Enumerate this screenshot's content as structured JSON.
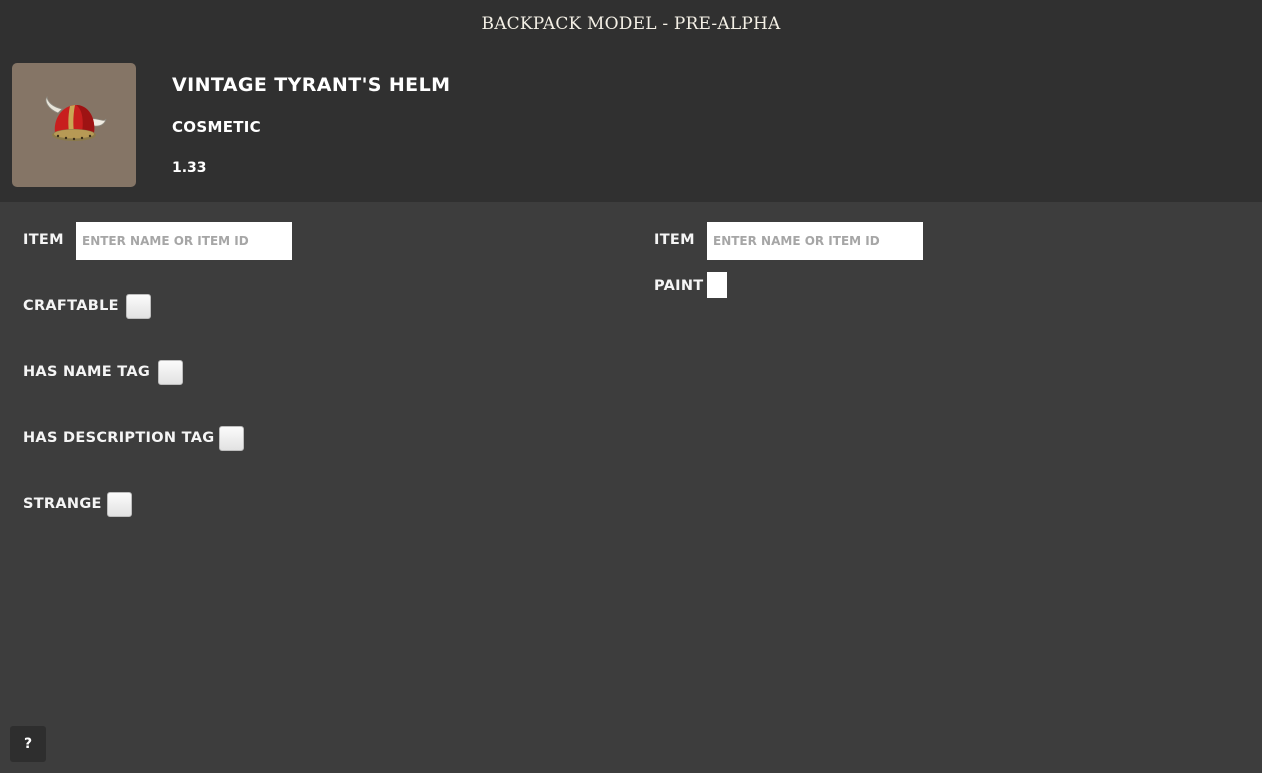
{
  "app": {
    "title": "BACKPACK MODEL - PRE-ALPHA"
  },
  "item": {
    "icon": "viking-helmet-image",
    "name": "VINTAGE TYRANT'S HELM",
    "type": "COSMETIC",
    "value": "1.33"
  },
  "left_panel": {
    "item_label": "ITEM",
    "item_input_value": "",
    "item_input_placeholder": "ENTER NAME OR ITEM ID",
    "options": [
      {
        "label": "CRAFTABLE",
        "checked": false
      },
      {
        "label": "HAS NAME TAG",
        "checked": false
      },
      {
        "label": "HAS DESCRIPTION TAG",
        "checked": false
      },
      {
        "label": "STRANGE",
        "checked": false
      }
    ]
  },
  "right_panel": {
    "item_label": "ITEM",
    "item_input_value": "",
    "item_input_placeholder": "ENTER NAME OR ITEM ID",
    "paint_label": "PAINT",
    "paint_color": "#ffffff"
  },
  "help": {
    "label": "?"
  },
  "colors": {
    "page_background": "#3d3d3d",
    "header_background": "#303030",
    "thumbnail_background": "#857566",
    "text": "#ffffff"
  }
}
